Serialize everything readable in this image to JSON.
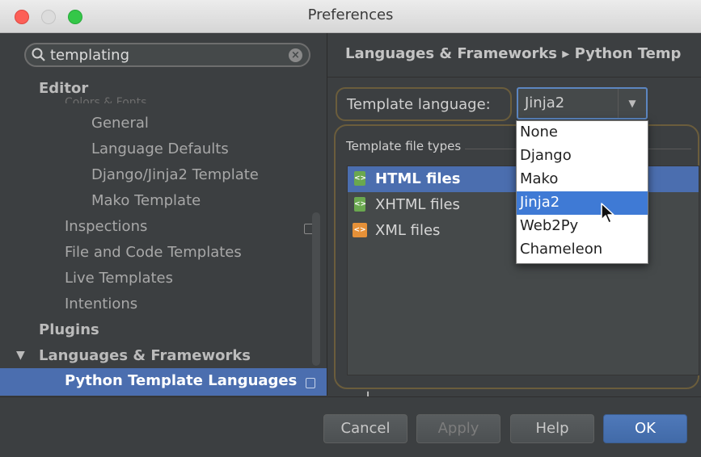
{
  "window": {
    "title": "Preferences"
  },
  "search": {
    "value": "templating"
  },
  "tree": {
    "editor": "Editor",
    "struck_item": "Colors & Fonts",
    "general": "General",
    "language_defaults": "Language Defaults",
    "django_jinja2": "Django/Jinja2 Template",
    "mako_template": "Mako Template",
    "inspections": "Inspections",
    "file_code_templates": "File and Code Templates",
    "live_templates": "Live Templates",
    "intentions": "Intentions",
    "plugins": "Plugins",
    "languages_frameworks": "Languages & Frameworks",
    "python_template_languages": "Python Template Languages"
  },
  "header": {
    "breadcrumb": "Languages & Frameworks ▸ Python Temp"
  },
  "template_language": {
    "label": "Template language:",
    "value": "Jinja2",
    "options": [
      "None",
      "Django",
      "Mako",
      "Jinja2",
      "Web2Py",
      "Chameleon"
    ],
    "highlighted": "Jinja2"
  },
  "file_types": {
    "title": "Template file types",
    "items": [
      {
        "label": "HTML files",
        "icon": "html-file-icon",
        "selected": true
      },
      {
        "label": "XHTML files",
        "icon": "xhtml-file-icon",
        "selected": false
      },
      {
        "label": "XML files",
        "icon": "xml-file-icon",
        "selected": false
      }
    ],
    "add_label": "+",
    "remove_label": "−"
  },
  "buttons": {
    "cancel": "Cancel",
    "apply": "Apply",
    "help": "Help",
    "ok": "OK"
  },
  "colors": {
    "selection": "#4b6eaf",
    "dropdown_highlight": "#3f7ad5",
    "panel": "#3c3f41"
  }
}
